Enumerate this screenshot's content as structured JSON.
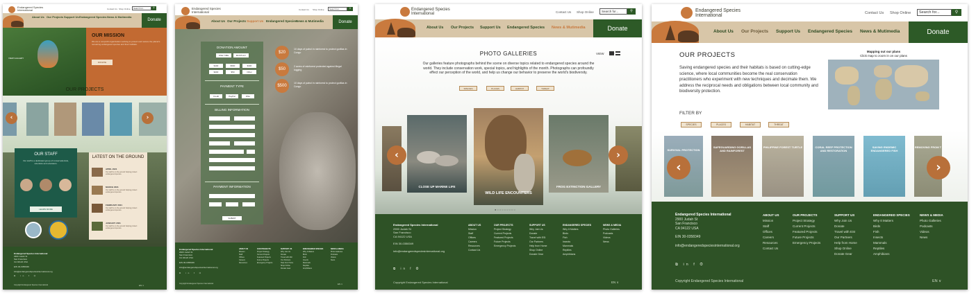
{
  "brand": {
    "name": "Endangered Species International",
    "name_line1": "Endangered Species",
    "name_line2": "International"
  },
  "util": {
    "contact": "Contact Us",
    "shop": "Shop Online",
    "search_placeholder": "Search for..."
  },
  "nav": [
    "About Us",
    "Our Projects",
    "Support Us",
    "Endangered Species",
    "News & Mutimedia"
  ],
  "donate": "Donate",
  "home": {
    "mission_title": "OUR MISSION",
    "mission_body": "We are a nonprofit organization working to protect and restore the planet's remaining endangered species and their habitats.",
    "mission_button": "DONATE",
    "projects_title": "OUR PROJECTS",
    "view_gallery": "VIEW GALLERY",
    "staff_title": "OUR STAFF",
    "staff_body": "Our staff is a dedicated group of conservationists, scientists and educators.",
    "learn_more": "LEARN MORE",
    "news_title": "LATEST ON THE GROUND",
    "news": [
      {
        "date": "APRIL 2021",
        "text": "Our staff is on the ground helping protect endangered species."
      },
      {
        "date": "MARCH 2021",
        "text": "Our staff is on the ground helping protect endangered species."
      },
      {
        "date": "FEBRUARY 2021",
        "text": "Our staff is on the ground helping protect endangered species."
      },
      {
        "date": "JANUARY 2021",
        "text": "Our staff is on the ground helping protect endangered species."
      }
    ]
  },
  "donation": {
    "amount_title": "DONATION AMOUNT",
    "freq": [
      "ONE TIME",
      "MONTHLY"
    ],
    "amounts": [
      "$100",
      "$500",
      "$300",
      "$200",
      "$50",
      "Other"
    ],
    "payment_type_title": "PAYMENT TYPE",
    "payment_types": [
      "Credit",
      "PayPal",
      "Wire"
    ],
    "billing_title": "BILLING INFORMATION",
    "payment_info_title": "PAYMENT INFORMATION",
    "submit": "SUBMIT",
    "tiers": [
      {
        "amount": "$20",
        "text": "10 days of patrol in rainforest to protect gorillas in Congo"
      },
      {
        "amount": "$50",
        "text": "2 acres of rainforest protected against illegal logging"
      },
      {
        "amount": "$500",
        "text": "10 days of patrol in rainforest to protect gorillas in Congo"
      }
    ]
  },
  "galleries": {
    "title": "PHOTO GALLERIES",
    "view_label": "VIEW",
    "intro": "Our galleries feature photographs behind the scene on diverse topics related to endangered species around the world. They include conservation work, special topics, and highlights of the month. Photographs can profoundly effect our perception of the world, and help us change our behavior to preserve the world's biodiversity.",
    "filters": [
      "SPECIES",
      "PLACES",
      "HABITAT",
      "THREAT"
    ],
    "cards": [
      "CLOSE UP MARINE LIFE",
      "WILD LIFE ENCOUNTERS",
      "FROG EXTINCTION GALLERY"
    ]
  },
  "projects": {
    "title": "OUR PROJECTS",
    "body": "Saving endangered species and their habitats is based on cutting-edge science, where local communities become the real conservation practitioners who experiment with new techniques and decimate them. We address the reciprocal needs and obligations between local community and biodiversity protection.",
    "map_title": "Mapping out our plans",
    "map_sub": "Click map to zoom in on our plans",
    "filter_by": "FILTER BY",
    "filters": [
      "SPECIES",
      "PLACES",
      "HABITAT",
      "THREAT"
    ],
    "cards": [
      "SURVIVAL PROTECTION",
      "SAFEGUARDING GORILLAS AND RAINFOREST",
      "PHILIPPINE FOREST TURTLE",
      "CORAL REEF PROTECTION AND RESTORATION",
      "SAVING ENDEMIC ENDANGERED FISH",
      "REMOVING FROM T"
    ]
  },
  "footer": {
    "org": "Endangered Species International",
    "address": [
      "2900 Judah St",
      "San Francisco",
      "CA 94122 USA"
    ],
    "ein": "EIN 30-0358349",
    "email": "info@endangeredspeciesinternational.org",
    "socials": "⧉ in f ◎",
    "copyright": "Copyright  Endangered Species International",
    "lang": "EN ∨",
    "cols": [
      {
        "title": "ABOUT US",
        "items": [
          "Mission",
          "Staff",
          "Offices",
          "Careers",
          "Resources",
          "Contact Us"
        ]
      },
      {
        "title": "OUR PROJECTS",
        "items": [
          "Project Strategy",
          "Current Projects",
          "Featured Projects",
          "Future Projects",
          "Emergency  Projects"
        ]
      },
      {
        "title": "SUPPORT US",
        "items": [
          "Why Join Us",
          "Donate",
          "Travel with ESI",
          "Our Partners",
          "Help from Home",
          "Shop Online",
          "Donate Gear"
        ]
      },
      {
        "title": "ENDANGERED SPECIES",
        "items": [
          "Why It Matters",
          "Birds",
          "Fish",
          "Insects",
          "Mammals",
          "Reptiles",
          "Amphibians"
        ]
      },
      {
        "title": "NEWS & MEDIA",
        "items": [
          "Photo Galleries",
          "Podcasts",
          "Videos",
          "News"
        ]
      }
    ]
  },
  "colors": {
    "accent": "#c97a3e",
    "green": "#2d5a27",
    "tan": "#d8c6a8"
  }
}
